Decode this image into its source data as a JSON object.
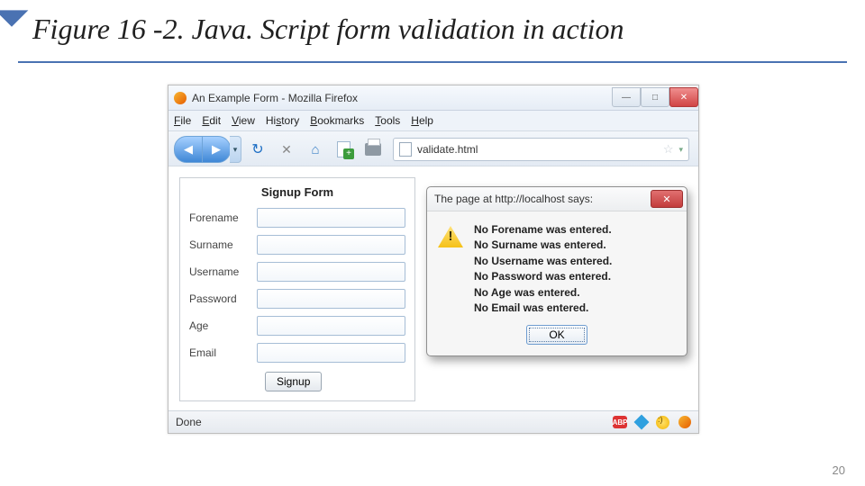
{
  "slide": {
    "title": "Figure 16 -2. Java. Script form validation in action",
    "page": "20"
  },
  "window": {
    "title": "An Example Form - Mozilla Firefox",
    "menus": [
      "File",
      "Edit",
      "View",
      "History",
      "Bookmarks",
      "Tools",
      "Help"
    ],
    "url": "validate.html",
    "status": "Done"
  },
  "form": {
    "title": "Signup Form",
    "fields": [
      {
        "label": "Forename"
      },
      {
        "label": "Surname"
      },
      {
        "label": "Username"
      },
      {
        "label": "Password"
      },
      {
        "label": "Age"
      },
      {
        "label": "Email"
      }
    ],
    "submit": "Signup"
  },
  "alert": {
    "title": "The page at http://localhost says:",
    "messages": [
      "No Forename was entered.",
      "No Surname was entered.",
      "No Username was entered.",
      "No Password was entered.",
      "No Age was entered.",
      "No Email was entered."
    ],
    "ok": "OK"
  }
}
